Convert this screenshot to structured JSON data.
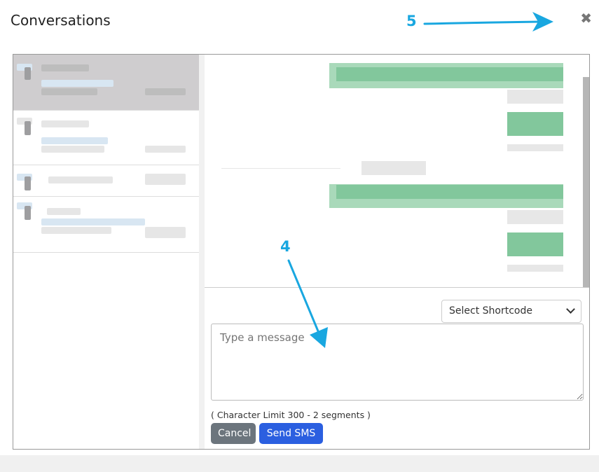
{
  "modal": {
    "title": "Conversations",
    "close_glyph": "✖"
  },
  "annotations": [
    {
      "label": "4"
    },
    {
      "label": "5"
    }
  ],
  "composer": {
    "shortcode_selected": "Select Shortcode",
    "message_placeholder": "Type a message",
    "char_limit_text": "( Character Limit 300 - 2 segments )",
    "cancel_label": "Cancel",
    "send_label": "Send SMS"
  },
  "colors": {
    "annotation": "#19a7e0",
    "send_button": "#2b5fe0",
    "cancel_button": "#6c757d",
    "bubble": "#82c79c"
  }
}
